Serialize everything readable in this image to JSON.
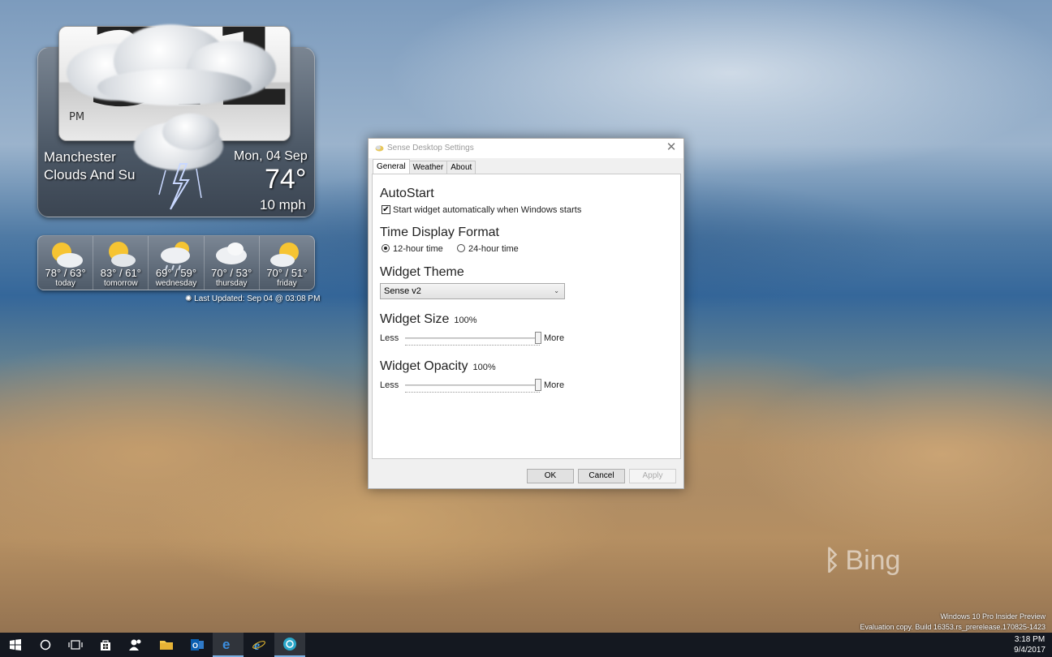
{
  "widget": {
    "time_digits": "3:18",
    "ampm": "PM",
    "city": "Manchester",
    "condition": "Clouds And Su",
    "date": "Mon, 04 Sep",
    "temp": "74°",
    "wind": "10 mph",
    "forecast": [
      {
        "temps": "78° / 63°",
        "day": "today"
      },
      {
        "temps": "83° / 61°",
        "day": "tomorrow"
      },
      {
        "temps": "69° / 59°",
        "day": "wednesday"
      },
      {
        "temps": "70° / 53°",
        "day": "thursday"
      },
      {
        "temps": "70° / 51°",
        "day": "friday"
      }
    ],
    "last_updated": "Last Updated: Sep 04 @ 03:08 PM"
  },
  "dialog": {
    "title": "Sense Desktop Settings",
    "tabs": [
      "General",
      "Weather",
      "About"
    ],
    "autostart_heading": "AutoStart",
    "autostart_label": "Start widget automatically when Windows starts",
    "autostart_checked": true,
    "time_format_heading": "Time Display Format",
    "time_12_label": "12-hour time",
    "time_24_label": "24-hour time",
    "time_format_selected": "12-hour time",
    "theme_heading": "Widget Theme",
    "theme_value": "Sense v2",
    "size_heading": "Widget Size",
    "size_value": "100%",
    "opacity_heading": "Widget Opacity",
    "opacity_value": "100%",
    "less_label": "Less",
    "more_label": "More",
    "ok_label": "OK",
    "cancel_label": "Cancel",
    "apply_label": "Apply"
  },
  "desktop": {
    "bing_label": "Bing",
    "watermark_line1": "Windows 10 Pro Insider Preview",
    "watermark_line2": "Evaluation copy. Build 16353.rs_prerelease.170825-1423"
  },
  "taskbar": {
    "clock_time": "3:18 PM",
    "clock_date": "9/4/2017",
    "items": [
      "start-icon",
      "cortana-icon",
      "task-view-icon",
      "store-icon",
      "people-icon",
      "file-explorer-icon",
      "outlook-icon",
      "edge-icon",
      "internet-explorer-icon",
      "weather-app-icon"
    ]
  }
}
